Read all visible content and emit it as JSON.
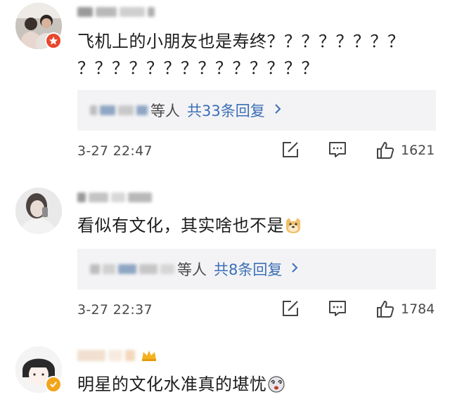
{
  "comments": [
    {
      "text_lines": [
        "飞机上的小朋友也是寿终？？？？？？？？",
        "？？？？？？？？？？？？？？"
      ],
      "replies": {
        "deng": "等人",
        "link": "共33条回复"
      },
      "timestamp": "3-27 22:47",
      "likes": "1621",
      "badge_color": "#e8472d"
    },
    {
      "text": "看似有文化，其实啥也不是",
      "emoji_icon": "doge-emoji-icon",
      "replies": {
        "deng": "等人",
        "link": "共8条回复"
      },
      "timestamp": "3-27 22:37",
      "likes": "1784"
    },
    {
      "text": "明星的文化水准真的堪忧",
      "emoji_icon": "dizzy-emoji-icon",
      "badge_color": "#f2a51c"
    }
  ],
  "colors": {
    "link": "#3b6fb6",
    "reply_box_bg": "#f3f3f5",
    "meta_text": "#4a4a4a"
  }
}
